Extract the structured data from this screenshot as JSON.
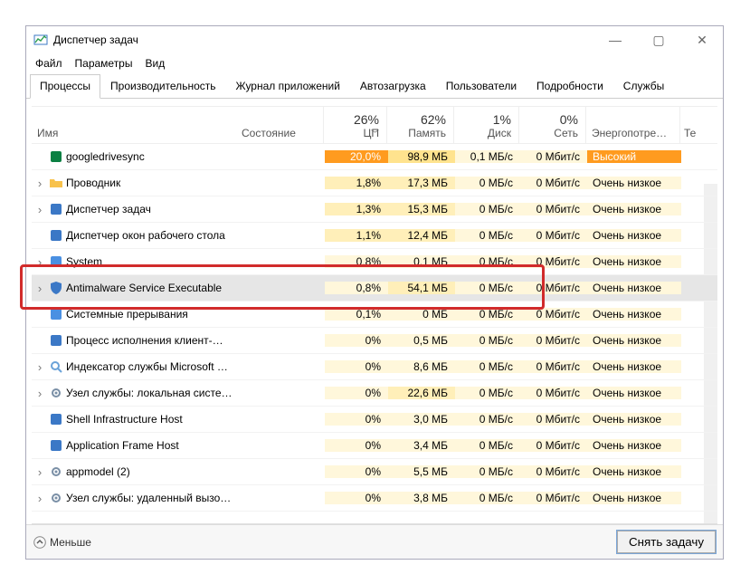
{
  "window": {
    "title": "Диспетчер задач"
  },
  "menu": [
    "Файл",
    "Параметры",
    "Вид"
  ],
  "tabs": [
    "Процессы",
    "Производительность",
    "Журнал приложений",
    "Автозагрузка",
    "Пользователи",
    "Подробности",
    "Службы"
  ],
  "active_tab": 0,
  "headers": {
    "name": "Имя",
    "state": "Состояние",
    "cpu_pct": "26%",
    "cpu": "ЦП",
    "mem_pct": "62%",
    "mem": "Память",
    "disk_pct": "1%",
    "disk": "Диск",
    "net_pct": "0%",
    "net": "Сеть",
    "power": "Энергопотре…",
    "te": "Те"
  },
  "rows": [
    {
      "exp": false,
      "icon": "gdrive",
      "name": "googledrivesync",
      "cpu": "20,0%",
      "cpu_cls": "bg5",
      "mem": "98,9 МБ",
      "mem_cls": "bg3",
      "disk": "0,1 МБ/с",
      "disk_cls": "bg1",
      "net": "0 Мбит/с",
      "net_cls": "bg1",
      "pow": "Высокий",
      "pow_cls": "bg5"
    },
    {
      "exp": true,
      "icon": "folder",
      "name": "Проводник",
      "cpu": "1,8%",
      "cpu_cls": "bg2",
      "mem": "17,3 МБ",
      "mem_cls": "bg2",
      "disk": "0 МБ/с",
      "disk_cls": "bg1",
      "net": "0 Мбит/с",
      "net_cls": "bg1",
      "pow": "Очень низкое",
      "pow_cls": "bg1"
    },
    {
      "exp": true,
      "icon": "taskmgr",
      "name": "Диспетчер задач",
      "cpu": "1,3%",
      "cpu_cls": "bg2",
      "mem": "15,3 МБ",
      "mem_cls": "bg2",
      "disk": "0 МБ/с",
      "disk_cls": "bg1",
      "net": "0 Мбит/с",
      "net_cls": "bg1",
      "pow": "Очень низкое",
      "pow_cls": "bg1"
    },
    {
      "exp": false,
      "icon": "dwm",
      "name": "Диспетчер окон рабочего стола",
      "cpu": "1,1%",
      "cpu_cls": "bg2",
      "mem": "12,4 МБ",
      "mem_cls": "bg2",
      "disk": "0 МБ/с",
      "disk_cls": "bg1",
      "net": "0 Мбит/с",
      "net_cls": "bg1",
      "pow": "Очень низкое",
      "pow_cls": "bg1"
    },
    {
      "exp": true,
      "icon": "sys",
      "name": "System",
      "cpu": "0,8%",
      "cpu_cls": "bg1",
      "mem": "0,1 МБ",
      "mem_cls": "bg1",
      "disk": "0 МБ/с",
      "disk_cls": "bg1",
      "net": "0 Мбит/с",
      "net_cls": "bg1",
      "pow": "Очень низкое",
      "pow_cls": "bg1"
    },
    {
      "exp": true,
      "icon": "shield",
      "name": "Antimalware Service Executable",
      "cpu": "0,8%",
      "cpu_cls": "bg1",
      "mem": "54,1 МБ",
      "mem_cls": "bg2",
      "disk": "0 МБ/с",
      "disk_cls": "bg1",
      "net": "0 Мбит/с",
      "net_cls": "bg1",
      "pow": "Очень низкое",
      "pow_cls": "bg1",
      "selected": true
    },
    {
      "exp": false,
      "icon": "sys",
      "name": "Системные прерывания",
      "cpu": "0,1%",
      "cpu_cls": "bg1",
      "mem": "0 МБ",
      "mem_cls": "bg1",
      "disk": "0 МБ/с",
      "disk_cls": "bg1",
      "net": "0 Мбит/с",
      "net_cls": "bg1",
      "pow": "Очень низкое",
      "pow_cls": "bg1"
    },
    {
      "exp": false,
      "icon": "app",
      "name": "Процесс исполнения клиент-…",
      "cpu": "0%",
      "cpu_cls": "bg1",
      "mem": "0,5 МБ",
      "mem_cls": "bg1",
      "disk": "0 МБ/с",
      "disk_cls": "bg1",
      "net": "0 Мбит/с",
      "net_cls": "bg1",
      "pow": "Очень низкое",
      "pow_cls": "bg1"
    },
    {
      "exp": true,
      "icon": "search",
      "name": "Индексатор службы Microsoft …",
      "cpu": "0%",
      "cpu_cls": "bg1",
      "mem": "8,6 МБ",
      "mem_cls": "bg1",
      "disk": "0 МБ/с",
      "disk_cls": "bg1",
      "net": "0 Мбит/с",
      "net_cls": "bg1",
      "pow": "Очень низкое",
      "pow_cls": "bg1"
    },
    {
      "exp": true,
      "icon": "gear",
      "name": "Узел службы: локальная систе…",
      "cpu": "0%",
      "cpu_cls": "bg1",
      "mem": "22,6 МБ",
      "mem_cls": "bg2",
      "disk": "0 МБ/с",
      "disk_cls": "bg1",
      "net": "0 Мбит/с",
      "net_cls": "bg1",
      "pow": "Очень низкое",
      "pow_cls": "bg1"
    },
    {
      "exp": false,
      "icon": "app",
      "name": "Shell Infrastructure Host",
      "cpu": "0%",
      "cpu_cls": "bg1",
      "mem": "3,0 МБ",
      "mem_cls": "bg1",
      "disk": "0 МБ/с",
      "disk_cls": "bg1",
      "net": "0 Мбит/с",
      "net_cls": "bg1",
      "pow": "Очень низкое",
      "pow_cls": "bg1"
    },
    {
      "exp": false,
      "icon": "app",
      "name": "Application Frame Host",
      "cpu": "0%",
      "cpu_cls": "bg1",
      "mem": "3,4 МБ",
      "mem_cls": "bg1",
      "disk": "0 МБ/с",
      "disk_cls": "bg1",
      "net": "0 Мбит/с",
      "net_cls": "bg1",
      "pow": "Очень низкое",
      "pow_cls": "bg1"
    },
    {
      "exp": true,
      "icon": "gear",
      "name": "appmodel (2)",
      "cpu": "0%",
      "cpu_cls": "bg1",
      "mem": "5,5 МБ",
      "mem_cls": "bg1",
      "disk": "0 МБ/с",
      "disk_cls": "bg1",
      "net": "0 Мбит/с",
      "net_cls": "bg1",
      "pow": "Очень низкое",
      "pow_cls": "bg1"
    },
    {
      "exp": true,
      "icon": "gear",
      "name": "Узел службы: удаленный вызо…",
      "cpu": "0%",
      "cpu_cls": "bg1",
      "mem": "3,8 МБ",
      "mem_cls": "bg1",
      "disk": "0 МБ/с",
      "disk_cls": "bg1",
      "net": "0 Мбит/с",
      "net_cls": "bg1",
      "pow": "Очень низкое",
      "pow_cls": "bg1"
    }
  ],
  "footer": {
    "fewer": "Меньше",
    "endtask": "Снять задачу"
  },
  "icons": {
    "gdrive": "#0b8043",
    "folder": "#f8c24c",
    "taskmgr": "#3b78c6",
    "dwm": "#3b78c6",
    "sys": "#4a90e2",
    "shield": "#3b78c6",
    "app": "#3b78c6",
    "search": "#6aa2d8",
    "gear": "#7a8fa6"
  }
}
